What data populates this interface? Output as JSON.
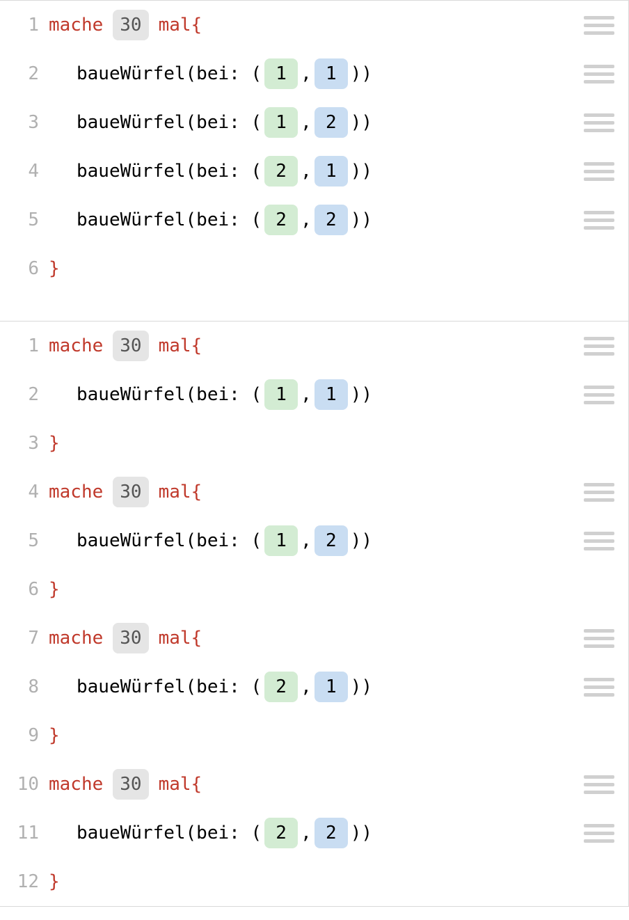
{
  "tokens": {
    "mache": "mache",
    "mal_brace": "mal{",
    "close_brace": "}",
    "call_open": "baueWürfel(bei: (",
    "comma": ",",
    "call_close": "))"
  },
  "panels": [
    {
      "lines": [
        {
          "n": "1",
          "type": "loop",
          "count": "30",
          "drag": true
        },
        {
          "n": "2",
          "type": "call",
          "a": "1",
          "b": "1",
          "drag": true
        },
        {
          "n": "3",
          "type": "call",
          "a": "1",
          "b": "2",
          "drag": true
        },
        {
          "n": "4",
          "type": "call",
          "a": "2",
          "b": "1",
          "drag": true
        },
        {
          "n": "5",
          "type": "call",
          "a": "2",
          "b": "2",
          "drag": true
        },
        {
          "n": "6",
          "type": "close",
          "drag": false
        }
      ],
      "extra_bottom_pad": true
    },
    {
      "lines": [
        {
          "n": "1",
          "type": "loop",
          "count": "30",
          "drag": true
        },
        {
          "n": "2",
          "type": "call",
          "a": "1",
          "b": "1",
          "drag": true
        },
        {
          "n": "3",
          "type": "close",
          "drag": false
        },
        {
          "n": "4",
          "type": "loop",
          "count": "30",
          "drag": true
        },
        {
          "n": "5",
          "type": "call",
          "a": "1",
          "b": "2",
          "drag": true
        },
        {
          "n": "6",
          "type": "close",
          "drag": false
        },
        {
          "n": "7",
          "type": "loop",
          "count": "30",
          "drag": true
        },
        {
          "n": "8",
          "type": "call",
          "a": "2",
          "b": "1",
          "drag": true
        },
        {
          "n": "9",
          "type": "close",
          "drag": false
        },
        {
          "n": "10",
          "type": "loop",
          "count": "30",
          "drag": true
        },
        {
          "n": "11",
          "type": "call",
          "a": "2",
          "b": "2",
          "drag": true
        },
        {
          "n": "12",
          "type": "close",
          "drag": false
        }
      ],
      "extra_bottom_pad": false
    }
  ]
}
